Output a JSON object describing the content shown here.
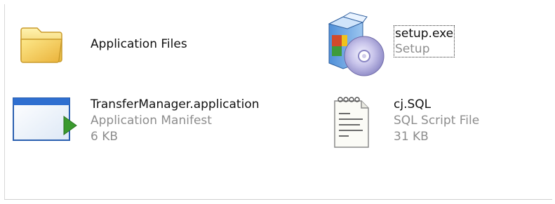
{
  "files": {
    "application_files": {
      "name": "Application Files",
      "icon": "folder-icon"
    },
    "setup": {
      "name": "setup.exe",
      "type": "Setup",
      "icon": "installer-cd-icon"
    },
    "manifest": {
      "name": "TransferManager.application",
      "type": "Application Manifest",
      "size": "6 KB",
      "icon": "application-manifest-icon"
    },
    "sql": {
      "name": "cj.SQL",
      "type": "SQL Script File",
      "size": "31 KB",
      "icon": "sql-script-icon"
    }
  },
  "colors": {
    "name_text": "#111111",
    "detail_text": "#8d8d8d",
    "folder_yellow": "#f5d35a",
    "manifest_blue": "#2f6fd0",
    "play_green": "#3a9a2e"
  }
}
